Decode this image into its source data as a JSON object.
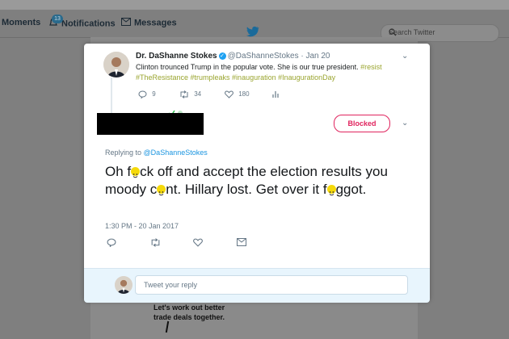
{
  "nav": {
    "moments_label": "Moments",
    "notifications_label": "Notifications",
    "notifications_badge": "13",
    "messages_label": "Messages",
    "search_placeholder": "Search Twitter"
  },
  "background": {
    "image_caption_line1": "Let's work out better",
    "image_caption_line2": "trade deals together."
  },
  "original_tweet": {
    "name": "Dr. DaShanne Stokes",
    "handle": "@DaShanneStokes",
    "date": "· Jan 20",
    "text": "Clinton trounced Trump in the popular vote. She is our true president.",
    "hashtags_line1": "#resist",
    "hashtags_line2": "#TheResistance #trumpleaks #inauguration #InaugurationDay",
    "replies": "9",
    "retweets": "34",
    "likes": "180"
  },
  "reply_tweet": {
    "blocked_label": "Blocked",
    "replying_prefix": "Replying to",
    "replying_to": "@DaShanneStokes",
    "text_part1": "Oh f",
    "text_part2": "ck off and accept the election results you moody c",
    "text_part3": "nt. Hillary lost. Get over it f",
    "text_part4": "ggot.",
    "timestamp": "1:30 PM - 20 Jan 2017"
  },
  "reply_box": {
    "placeholder": "Tweet your reply"
  },
  "colors": {
    "accent": "#1da1f2",
    "blocked": "#e0245e",
    "hashtag": "#9aa52f"
  }
}
